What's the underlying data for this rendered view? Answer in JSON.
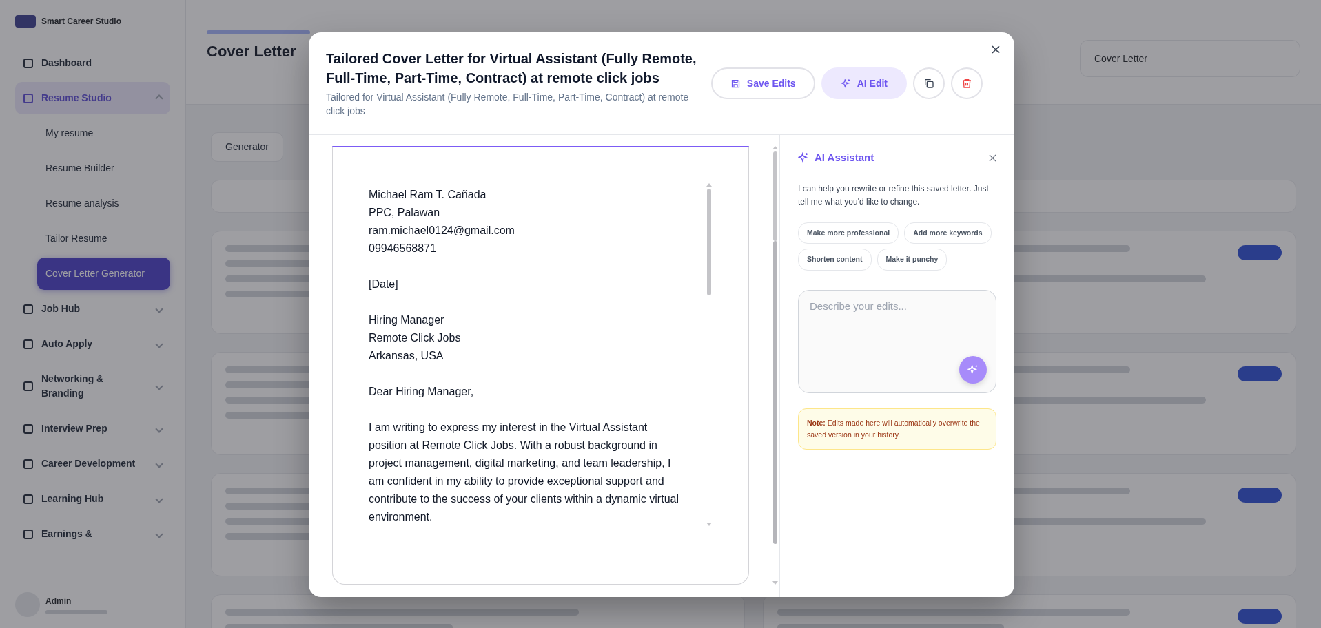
{
  "sidebar": {
    "brand": "Smart Career Studio",
    "items": [
      {
        "label": "Dashboard",
        "kind": "link",
        "selected": false
      },
      {
        "label": "Resume Studio",
        "kind": "group",
        "expanded": true,
        "selected": true,
        "children": [
          {
            "label": "My resume",
            "selected": false
          },
          {
            "label": "Resume Builder",
            "selected": false
          },
          {
            "label": "Resume analysis",
            "selected": false
          },
          {
            "label": "Tailor Resume",
            "selected": false
          },
          {
            "label": "Cover Letter Generator",
            "selected": true
          }
        ]
      },
      {
        "label": "Job Hub",
        "kind": "group",
        "expanded": false,
        "selected": false
      },
      {
        "label": "Auto Apply",
        "kind": "group",
        "expanded": false,
        "selected": false
      },
      {
        "label": "Networking & Branding",
        "kind": "group",
        "expanded": false,
        "selected": false
      },
      {
        "label": "Interview Prep",
        "kind": "group",
        "expanded": false,
        "selected": false
      },
      {
        "label": "Career Development",
        "kind": "group",
        "expanded": false,
        "selected": false
      },
      {
        "label": "Learning Hub",
        "kind": "group",
        "expanded": false,
        "selected": false
      },
      {
        "label": "Earnings &",
        "kind": "group",
        "expanded": false,
        "selected": false
      }
    ],
    "user": {
      "name": "Admin"
    }
  },
  "page": {
    "title": "Cover Letter",
    "select": "Cover Letter",
    "tab": "Generator"
  },
  "modal": {
    "title": "Tailored Cover Letter for Virtual Assistant (Fully Remote, Full-Time, Part-Time, Contract) at remote click jobs",
    "subtitle": "Tailored for Virtual Assistant (Fully Remote, Full-Time, Part-Time, Contract) at remote click jobs",
    "buttons": [
      {
        "label": "Save Edits",
        "kind": "save"
      },
      {
        "label": "AI Edit",
        "kind": "ai"
      },
      {
        "kind": "copy"
      },
      {
        "kind": "delete"
      }
    ],
    "letter": [
      "Michael Ram T. Cañada\nPPC, Palawan\nram.michael0124@gmail.com\n09946568871",
      "[Date]",
      "Hiring Manager\nRemote Click Jobs\nArkansas, USA",
      "Dear Hiring Manager,",
      "I am writing to express my interest in the Virtual Assistant position at Remote Click Jobs. With a robust background in project management, digital marketing, and team leadership, I am confident in my ability to provide exceptional support and contribute to the success of your clients within a dynamic virtual environment."
    ],
    "assistant": {
      "title": "AI Assistant",
      "intro": "I can help you rewrite or refine this saved letter. Just tell me what you'd like to change.",
      "suggestions": [
        "Make more professional",
        "Add more keywords",
        "Shorten content",
        "Make it punchy"
      ],
      "placeholder": "Describe your edits...",
      "note": "**Note:** Edits made here will automatically overwrite the saved version in your history."
    }
  }
}
